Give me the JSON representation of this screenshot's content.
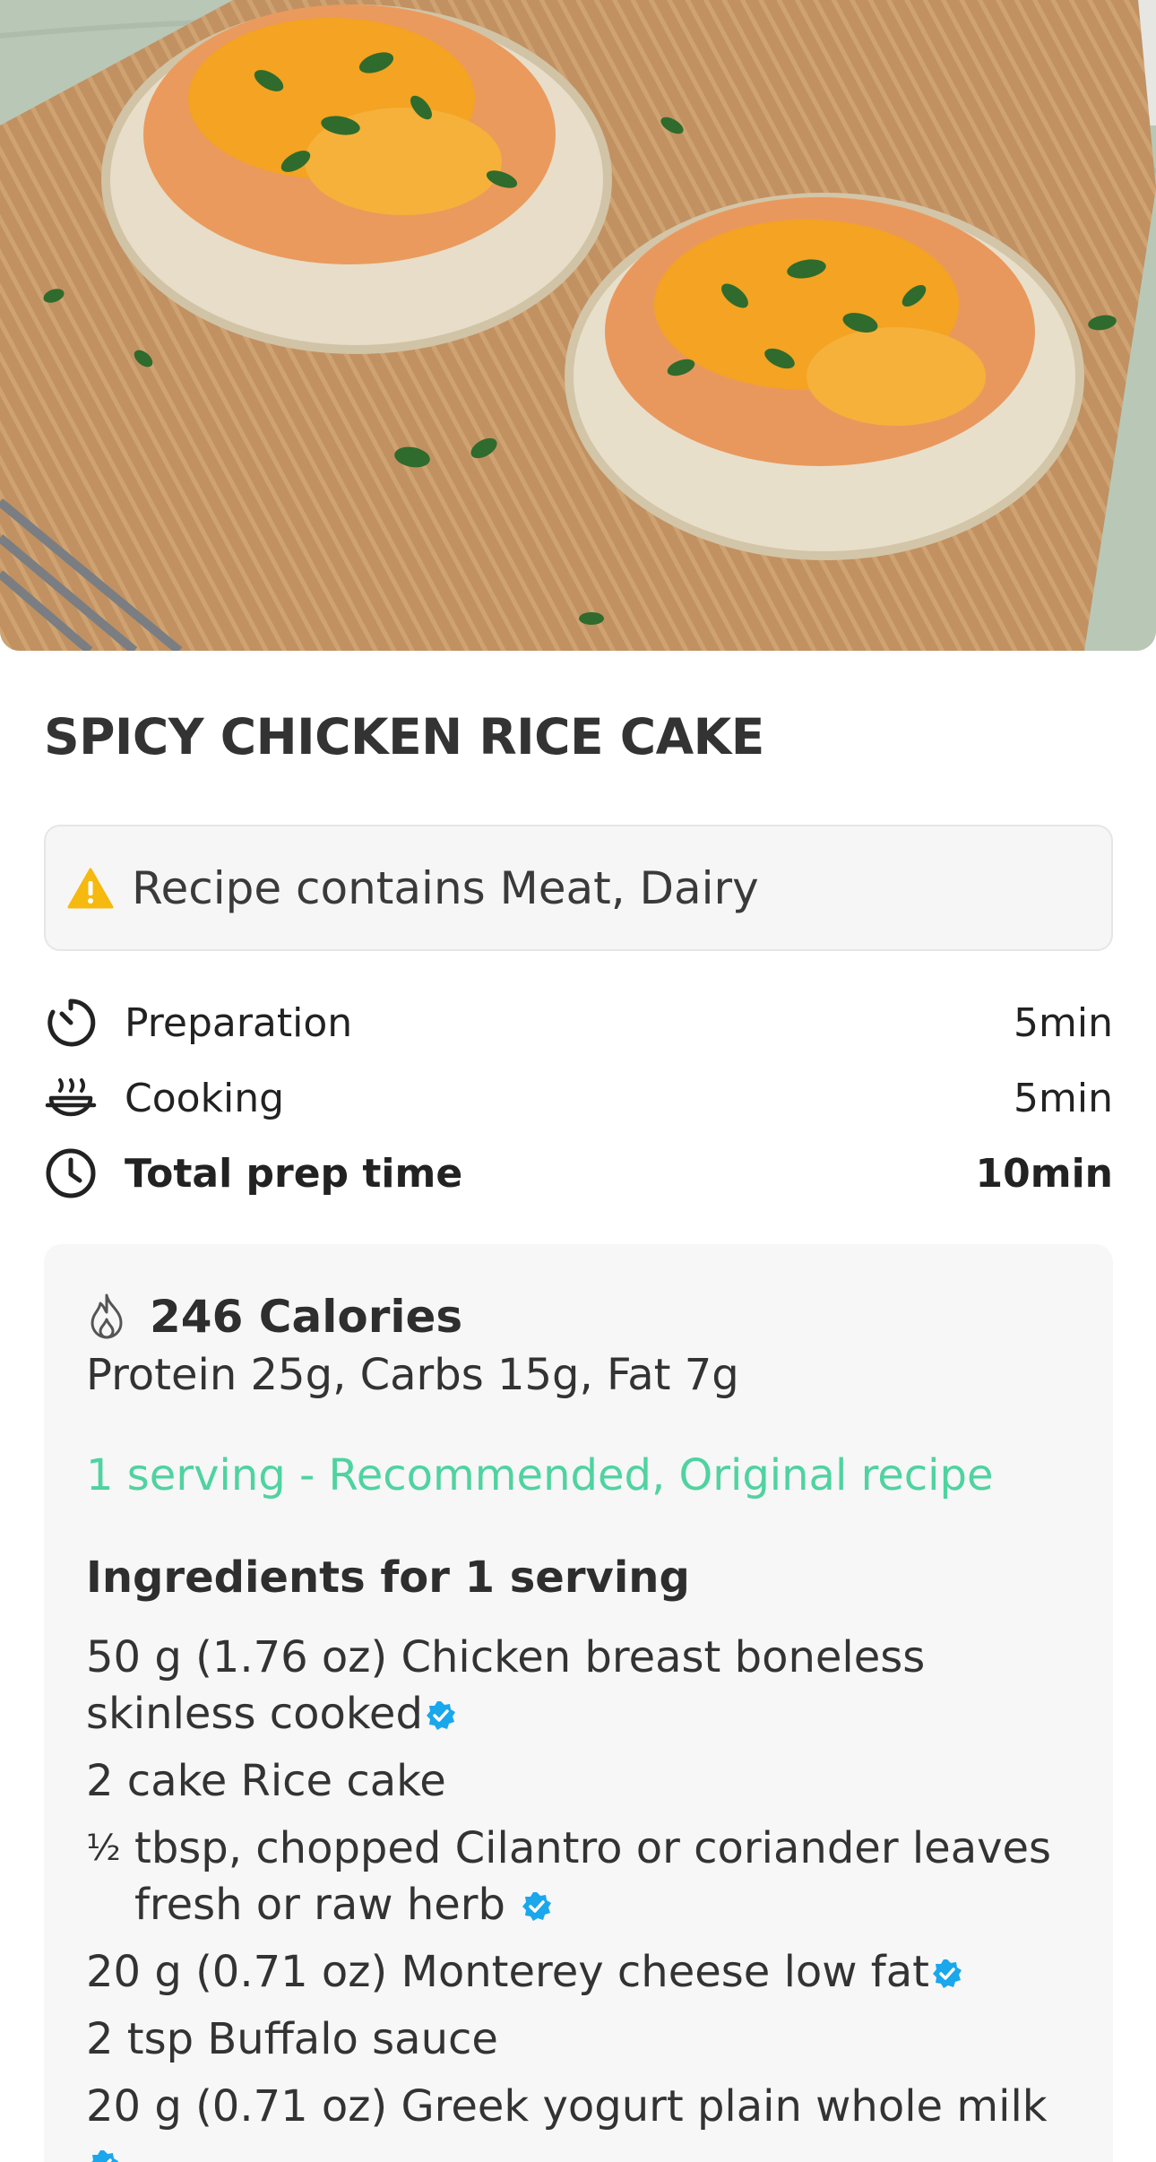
{
  "recipe": {
    "title": "SPICY CHICKEN RICE CAKE",
    "allergen_text": "Recipe contains Meat, Dairy"
  },
  "times": [
    {
      "label": "Preparation",
      "value": "5min",
      "icon": "timer-icon"
    },
    {
      "label": "Cooking",
      "value": "5min",
      "icon": "cooking-pot-icon"
    },
    {
      "label": "Total prep time",
      "value": "10min",
      "icon": "clock-icon"
    }
  ],
  "nutrition": {
    "calories": "246 Calories",
    "macros": "Protein 25g, Carbs 15g, Fat 7g",
    "serving": "1 serving - Recommended, Original recipe"
  },
  "ingredients": {
    "heading": "Ingredients for 1 serving",
    "items": [
      {
        "text": "50 g (1.76 oz) Chicken breast boneless skinless cooked",
        "verified": true
      },
      {
        "text": "2 cake Rice cake",
        "verified": false
      },
      {
        "fraction": "½",
        "text": "tbsp, chopped Cilantro or coriander leaves fresh or raw herb",
        "verified": true
      },
      {
        "text": "20 g (0.71 oz) Monterey cheese low fat",
        "verified": true
      },
      {
        "text": "2 tsp Buffalo sauce",
        "verified": false
      },
      {
        "text": "20 g (0.71 oz) Greek yogurt plain whole milk",
        "verified": true
      }
    ]
  },
  "colors": {
    "accent_green": "#4fd3a0",
    "warning_yellow": "#f5b90f",
    "verified_blue": "#1aa7ec",
    "card_bg": "#f7f7f7"
  }
}
